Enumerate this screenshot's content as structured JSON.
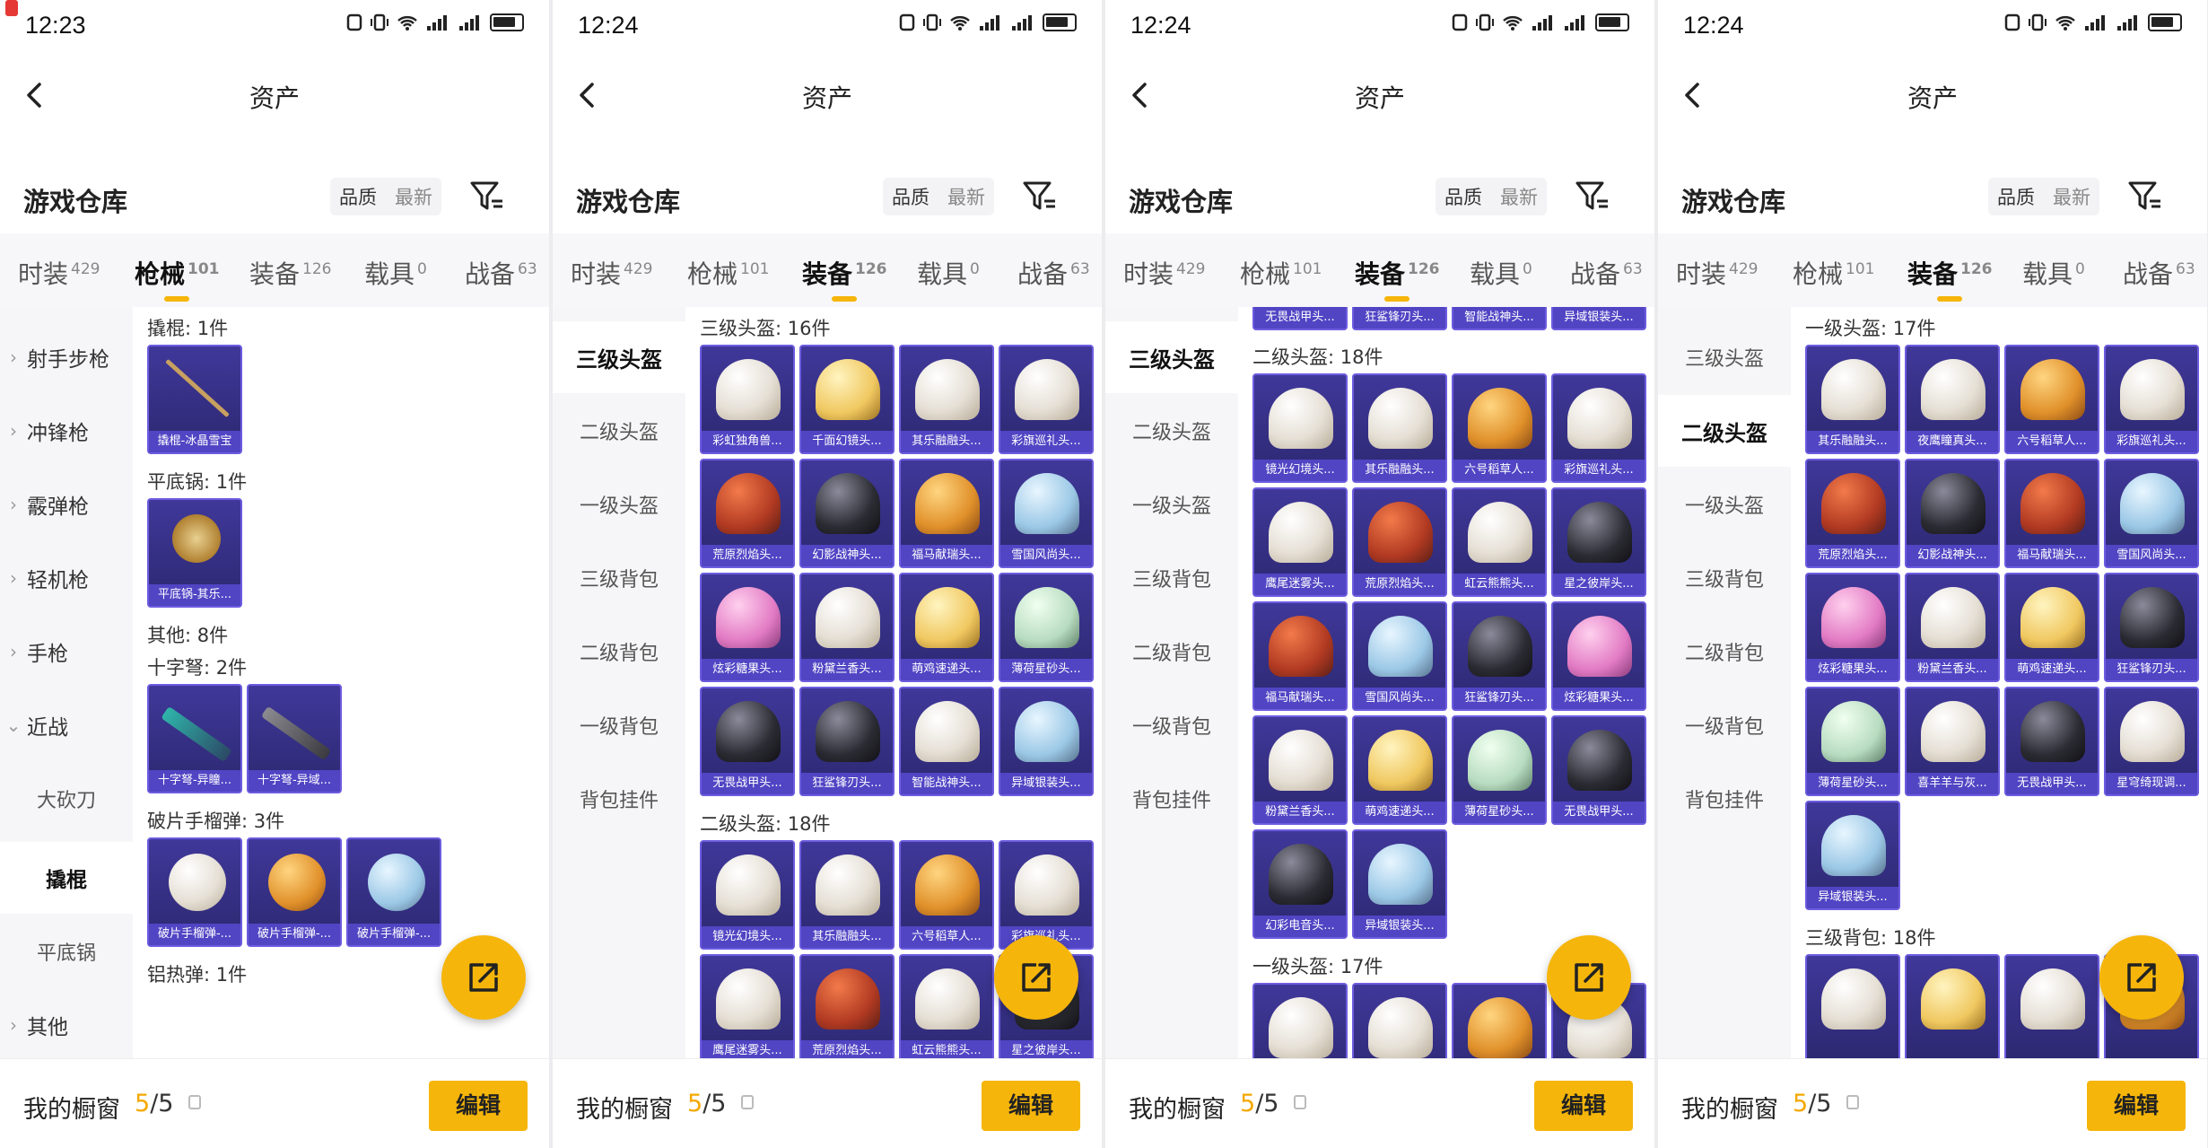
{
  "panels": [
    {
      "status": {
        "time": "12:23"
      },
      "title": "资产",
      "warehouse_title": "游戏仓库",
      "sort": [
        "品质",
        "最新"
      ],
      "tabs": [
        {
          "label": "时装",
          "count": "429"
        },
        {
          "label": "枪械",
          "count": "101"
        },
        {
          "label": "装备",
          "count": "126"
        },
        {
          "label": "载具",
          "count": "0"
        },
        {
          "label": "战备",
          "count": "63"
        }
      ],
      "active_tab": 1,
      "sidebar": [
        {
          "label": "射手步枪",
          "kind": "group"
        },
        {
          "label": "冲锋枪",
          "kind": "group"
        },
        {
          "label": "霰弹枪",
          "kind": "group"
        },
        {
          "label": "轻机枪",
          "kind": "group"
        },
        {
          "label": "手枪",
          "kind": "group"
        },
        {
          "label": "近战",
          "kind": "open"
        },
        {
          "label": "大砍刀",
          "kind": "sub"
        },
        {
          "label": "撬棍",
          "kind": "selected"
        },
        {
          "label": "平底锅",
          "kind": "sub"
        },
        {
          "label": "其他",
          "kind": "group"
        }
      ],
      "sections": [
        {
          "title": "撬棍: 1件",
          "items": [
            {
              "caption": "撬棍-冰晶雪宝",
              "art": "rod"
            }
          ]
        },
        {
          "title": "平底锅: 1件",
          "items": [
            {
              "caption": "平底锅-其乐...",
              "art": "pan"
            }
          ]
        },
        {
          "title": "其他: 8件",
          "items": []
        },
        {
          "title": "十字弩: 2件",
          "items": [
            {
              "caption": "十字弩-异瞳...",
              "art": "gun"
            },
            {
              "caption": "十字弩-异域...",
              "art": "gun2"
            }
          ]
        },
        {
          "title": "破片手榴弹: 3件",
          "items": [
            {
              "caption": "破片手榴弹-...",
              "art": "nade w"
            },
            {
              "caption": "破片手榴弹-...",
              "art": "nade o"
            },
            {
              "caption": "破片手榴弹-...",
              "art": "nade c"
            }
          ]
        },
        {
          "title": "铝热弹: 1件",
          "items": []
        }
      ],
      "bottom": {
        "label": "我的橱窗",
        "count_used": "5",
        "count_total": "/5",
        "edit": "编辑"
      }
    },
    {
      "status": {
        "time": "12:24"
      },
      "title": "资产",
      "warehouse_title": "游戏仓库",
      "sort": [
        "品质",
        "最新"
      ],
      "tabs": [
        {
          "label": "时装",
          "count": "429"
        },
        {
          "label": "枪械",
          "count": "101"
        },
        {
          "label": "装备",
          "count": "126"
        },
        {
          "label": "载具",
          "count": "0"
        },
        {
          "label": "战备",
          "count": "63"
        }
      ],
      "active_tab": 2,
      "sidebar": [
        {
          "label": "三级头盔",
          "kind": "selected"
        },
        {
          "label": "二级头盔",
          "kind": "sub"
        },
        {
          "label": "一级头盔",
          "kind": "sub"
        },
        {
          "label": "三级背包",
          "kind": "sub"
        },
        {
          "label": "二级背包",
          "kind": "sub"
        },
        {
          "label": "一级背包",
          "kind": "sub"
        },
        {
          "label": "背包挂件",
          "kind": "sub"
        }
      ],
      "sections": [
        {
          "title": "三级头盔: 16件",
          "items": [
            {
              "caption": "彩虹独角兽...",
              "art": "w"
            },
            {
              "caption": "千面幻镜头...",
              "art": "y"
            },
            {
              "caption": "其乐融融头...",
              "art": "w"
            },
            {
              "caption": "彩旗巡礼头...",
              "art": "w"
            },
            {
              "caption": "荒原烈焰头...",
              "art": "r"
            },
            {
              "caption": "幻影战神头...",
              "art": "b"
            },
            {
              "caption": "福马献瑞头...",
              "art": "o"
            },
            {
              "caption": "雪国风尚头...",
              "art": "c"
            },
            {
              "caption": "炫彩糖果头...",
              "art": "p"
            },
            {
              "caption": "粉黛兰香头...",
              "art": "w"
            },
            {
              "caption": "萌鸡速递头...",
              "art": "y"
            },
            {
              "caption": "薄荷星砂头...",
              "art": "g"
            },
            {
              "caption": "无畏战甲头...",
              "art": "b"
            },
            {
              "caption": "狂鲨锋刃头...",
              "art": "b"
            },
            {
              "caption": "智能战神头...",
              "art": "w"
            },
            {
              "caption": "异域银装头...",
              "art": "c"
            }
          ]
        },
        {
          "title": "二级头盔: 18件",
          "items": [
            {
              "caption": "镜光幻境头...",
              "art": "w"
            },
            {
              "caption": "其乐融融头...",
              "art": "w"
            },
            {
              "caption": "六号稻草人...",
              "art": "o"
            },
            {
              "caption": "彩旗巡礼头...",
              "art": "w"
            },
            {
              "caption": "鹰尾迷雾头...",
              "art": "w"
            },
            {
              "caption": "荒原烈焰头...",
              "art": "r"
            },
            {
              "caption": "虹云熊熊头...",
              "art": "w"
            },
            {
              "caption": "星之彼岸头...",
              "art": "b"
            }
          ]
        }
      ],
      "bottom": {
        "label": "我的橱窗",
        "count_used": "5",
        "count_total": "/5",
        "edit": "编辑"
      }
    },
    {
      "status": {
        "time": "12:24"
      },
      "title": "资产",
      "warehouse_title": "游戏仓库",
      "sort": [
        "品质",
        "最新"
      ],
      "tabs": [
        {
          "label": "时装",
          "count": "429"
        },
        {
          "label": "枪械",
          "count": "101"
        },
        {
          "label": "装备",
          "count": "126"
        },
        {
          "label": "载具",
          "count": "0"
        },
        {
          "label": "战备",
          "count": "63"
        }
      ],
      "active_tab": 2,
      "sidebar": [
        {
          "label": "三级头盔",
          "kind": "selected"
        },
        {
          "label": "二级头盔",
          "kind": "sub"
        },
        {
          "label": "一级头盔",
          "kind": "sub"
        },
        {
          "label": "三级背包",
          "kind": "sub"
        },
        {
          "label": "二级背包",
          "kind": "sub"
        },
        {
          "label": "一级背包",
          "kind": "sub"
        },
        {
          "label": "背包挂件",
          "kind": "sub"
        }
      ],
      "top_strip": [
        "无畏战甲头...",
        "狂鲨锋刃头...",
        "智能战神头...",
        "异域银装头..."
      ],
      "sections": [
        {
          "title": "二级头盔: 18件",
          "items": [
            {
              "caption": "镜光幻境头...",
              "art": "w"
            },
            {
              "caption": "其乐融融头...",
              "art": "w"
            },
            {
              "caption": "六号稻草人...",
              "art": "o"
            },
            {
              "caption": "彩旗巡礼头...",
              "art": "w"
            },
            {
              "caption": "鹰尾迷雾头...",
              "art": "w"
            },
            {
              "caption": "荒原烈焰头...",
              "art": "r"
            },
            {
              "caption": "虹云熊熊头...",
              "art": "w"
            },
            {
              "caption": "星之彼岸头...",
              "art": "b"
            },
            {
              "caption": "福马献瑞头...",
              "art": "r"
            },
            {
              "caption": "雪国风尚头...",
              "art": "c"
            },
            {
              "caption": "狂鲨锋刃头...",
              "art": "b"
            },
            {
              "caption": "炫彩糖果头...",
              "art": "p"
            },
            {
              "caption": "粉黛兰香头...",
              "art": "w"
            },
            {
              "caption": "萌鸡速递头...",
              "art": "y"
            },
            {
              "caption": "薄荷星砂头...",
              "art": "g"
            },
            {
              "caption": "无畏战甲头...",
              "art": "b"
            },
            {
              "caption": "幻彩电音头...",
              "art": "b"
            },
            {
              "caption": "异域银装头...",
              "art": "c"
            }
          ]
        },
        {
          "title": "一级头盔: 17件",
          "items": [
            {
              "caption": "",
              "art": "w"
            },
            {
              "caption": "",
              "art": "w"
            },
            {
              "caption": "",
              "art": "o"
            },
            {
              "caption": "",
              "art": "w"
            }
          ]
        }
      ],
      "bottom": {
        "label": "我的橱窗",
        "count_used": "5",
        "count_total": "/5",
        "edit": "编辑"
      }
    },
    {
      "status": {
        "time": "12:24"
      },
      "title": "资产",
      "warehouse_title": "游戏仓库",
      "sort": [
        "品质",
        "最新"
      ],
      "tabs": [
        {
          "label": "时装",
          "count": "429"
        },
        {
          "label": "枪械",
          "count": "101"
        },
        {
          "label": "装备",
          "count": "126"
        },
        {
          "label": "载具",
          "count": "0"
        },
        {
          "label": "战备",
          "count": "63"
        }
      ],
      "active_tab": 2,
      "sidebar": [
        {
          "label": "三级头盔",
          "kind": "sub"
        },
        {
          "label": "二级头盔",
          "kind": "selected"
        },
        {
          "label": "一级头盔",
          "kind": "sub"
        },
        {
          "label": "三级背包",
          "kind": "sub"
        },
        {
          "label": "二级背包",
          "kind": "sub"
        },
        {
          "label": "一级背包",
          "kind": "sub"
        },
        {
          "label": "背包挂件",
          "kind": "sub"
        }
      ],
      "sections": [
        {
          "title": "一级头盔: 17件",
          "items": [
            {
              "caption": "其乐融融头...",
              "art": "w"
            },
            {
              "caption": "夜鹰瞳真头...",
              "art": "w"
            },
            {
              "caption": "六号稻草人...",
              "art": "o"
            },
            {
              "caption": "彩旗巡礼头...",
              "art": "w"
            },
            {
              "caption": "荒原烈焰头...",
              "art": "r"
            },
            {
              "caption": "幻影战神头...",
              "art": "b"
            },
            {
              "caption": "福马献瑞头...",
              "art": "r"
            },
            {
              "caption": "雪国风尚头...",
              "art": "c"
            },
            {
              "caption": "炫彩糖果头...",
              "art": "p"
            },
            {
              "caption": "粉黛兰香头...",
              "art": "w"
            },
            {
              "caption": "萌鸡速递头...",
              "art": "y"
            },
            {
              "caption": "狂鲨锋刃头...",
              "art": "b"
            },
            {
              "caption": "薄荷星砂头...",
              "art": "g"
            },
            {
              "caption": "喜羊羊与灰...",
              "art": "w"
            },
            {
              "caption": "无畏战甲头...",
              "art": "b"
            },
            {
              "caption": "星穹绮现调...",
              "art": "w"
            },
            {
              "caption": "异域银装头...",
              "art": "c"
            }
          ]
        },
        {
          "title": "三级背包: 18件",
          "items": [
            {
              "caption": "",
              "art": "w"
            },
            {
              "caption": "",
              "art": "y"
            },
            {
              "caption": "",
              "art": "w"
            },
            {
              "caption": "",
              "art": "o"
            }
          ]
        }
      ],
      "bottom": {
        "label": "我的橱窗",
        "count_used": "5",
        "count_total": "/5",
        "edit": "编辑"
      }
    }
  ],
  "colors": {
    "accent": "#f5b50a",
    "card_bg": "#2c2870",
    "card_border": "#6d5ce0"
  },
  "icons": [
    "back-arrow-icon",
    "filter-icon",
    "share-fab-icon",
    "lock-icon",
    "nfc-icon",
    "vibrate-icon",
    "wifi-icon",
    "signal-icon",
    "battery-icon"
  ]
}
